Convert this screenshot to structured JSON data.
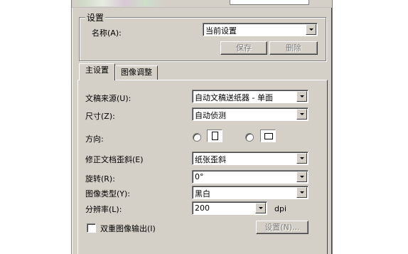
{
  "settings_group": {
    "title": "设置",
    "name_label": "名称(A):",
    "name_value": "当前设置",
    "save_button": "保存",
    "delete_button": "删除"
  },
  "tabs": [
    {
      "label": "主设置",
      "active": true
    },
    {
      "label": "图像调整",
      "active": false
    }
  ],
  "main_settings": {
    "document_source_label": "文稿来源(U):",
    "document_source_value": "自动文稿送纸器 - 单面",
    "size_label": "尺寸(Z):",
    "size_value": "自动侦测",
    "orientation_label": "方向:",
    "deskew_label": "修正文档歪斜(E)",
    "deskew_value": "纸张歪斜",
    "rotation_label": "旋转(R):",
    "rotation_value": "0°",
    "image_type_label": "图像类型(Y):",
    "image_type_value": "黑白",
    "resolution_label": "分辨率(L):",
    "resolution_value": "200",
    "resolution_unit": "dpi",
    "dual_output_label": "双重图像输出(I)",
    "dual_output_checked": false,
    "settings_button": "设置(N)..."
  }
}
